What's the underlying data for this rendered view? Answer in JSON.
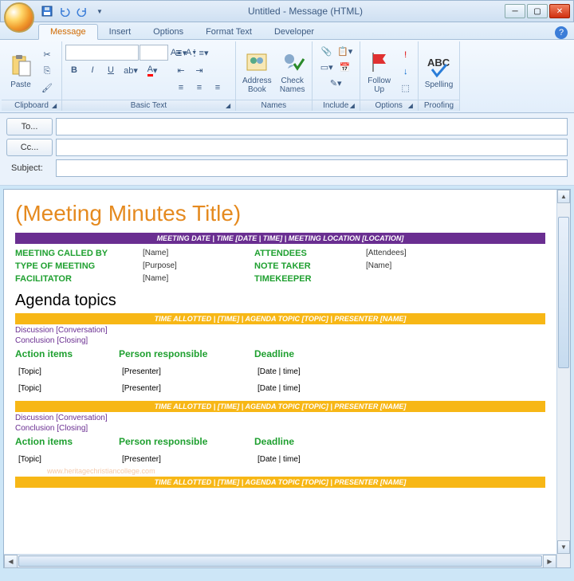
{
  "window": {
    "title": "Untitled - Message (HTML)"
  },
  "tabs": [
    "Message",
    "Insert",
    "Options",
    "Format Text",
    "Developer"
  ],
  "ribbon": {
    "clipboard": {
      "label": "Clipboard",
      "paste": "Paste"
    },
    "basic_text": {
      "label": "Basic Text"
    },
    "names": {
      "label": "Names",
      "address_book": "Address\nBook",
      "check_names": "Check\nNames"
    },
    "include": {
      "label": "Include"
    },
    "options": {
      "label": "Options",
      "follow_up": "Follow\nUp"
    },
    "proofing": {
      "label": "Proofing",
      "spelling": "Spelling"
    }
  },
  "address": {
    "to": "To...",
    "cc": "Cc...",
    "subject": "Subject:"
  },
  "document": {
    "title": "(Meeting Minutes Title)",
    "purple_bar": "MEETING DATE | TIME [DATE | TIME] | MEETING LOCATION [LOCATION]",
    "meta": {
      "called_by": "MEETING CALLED BY",
      "called_by_v": "[Name]",
      "type": "TYPE OF MEETING",
      "type_v": "[Purpose]",
      "facilitator": "FACILITATOR",
      "facilitator_v": "[Name]",
      "attendees": "ATTENDEES",
      "attendees_v": "[Attendees]",
      "note_taker": "NOTE TAKER",
      "note_taker_v": "[Name]",
      "timekeeper": "TIMEKEEPER"
    },
    "agenda_heading": "Agenda topics",
    "yellow_bar": "TIME ALLOTTED | [TIME] | AGENDA TOPIC [TOPIC] | PRESENTER [NAME]",
    "discussion": "Discussion [Conversation]",
    "conclusion": "Conclusion [Closing]",
    "cols": {
      "action": "Action items",
      "person": "Person responsible",
      "deadline": "Deadline"
    },
    "rows": [
      {
        "topic": "[Topic]",
        "presenter": "[Presenter]",
        "date": "[Date | time]"
      },
      {
        "topic": "[Topic]",
        "presenter": "[Presenter]",
        "date": "[Date | time]"
      }
    ],
    "rows2": [
      {
        "topic": "[Topic]",
        "presenter": "[Presenter]",
        "date": "[Date | time]"
      }
    ],
    "watermark": "www.heritagechristiancollege.com"
  }
}
